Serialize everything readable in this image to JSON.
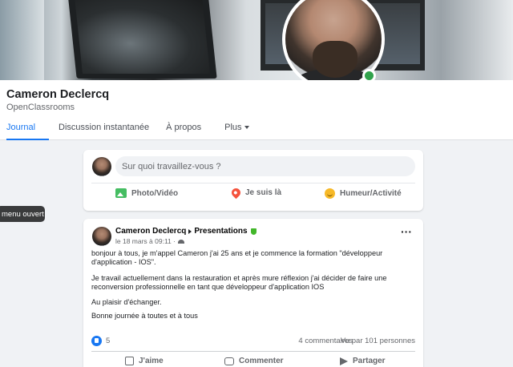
{
  "profile": {
    "name": "Cameron Declercq",
    "subtitle": "OpenClassrooms",
    "online_color": "#31a24c"
  },
  "tabs": [
    {
      "label": "Journal",
      "active": true
    },
    {
      "label": "Discussion instantanée",
      "active": false
    },
    {
      "label": "À propos",
      "active": false
    },
    {
      "label": "Plus",
      "active": false
    }
  ],
  "composer": {
    "placeholder": "Sur quoi travaillez-vous ?",
    "actions": [
      {
        "label": "Photo/Vidéo",
        "icon": "photo-icon"
      },
      {
        "label": "Je suis là",
        "icon": "location-pin-icon"
      },
      {
        "label": "Humeur/Activité",
        "icon": "smiley-icon"
      }
    ]
  },
  "tooltip": {
    "text": "menu ouvert"
  },
  "post": {
    "author": "Cameron Declercq",
    "group": "Presentations",
    "meta": "le 18 mars à 09:11 ·",
    "body": [
      "bonjour à tous, je m'appel Cameron j'ai 25 ans et je commence la formation \"développeur d'application - IOS\".",
      "Je travail actuellement dans la restauration et après mure réflexion j'ai décider de faire une reconversion professionnelle en tant que développeur d'application IOS",
      "Au plaisir d'échanger.",
      "Bonne journée à toutes et à tous"
    ],
    "like_count": "5",
    "comments": "4 commentaires",
    "views": "Vu par 101 personnes",
    "actions": [
      "J'aime",
      "Commenter",
      "Partager"
    ]
  },
  "colors": {
    "accent": "#1877f2",
    "background": "#f0f2f5"
  }
}
